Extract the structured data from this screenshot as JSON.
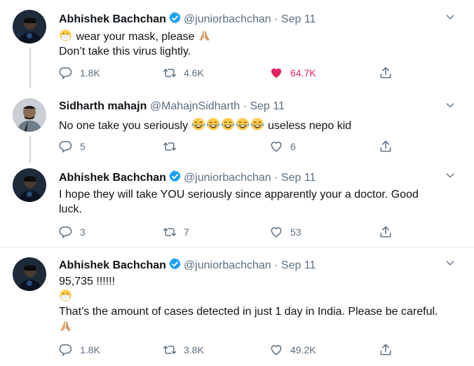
{
  "tweets": [
    {
      "name": "Abhishek Bachchan",
      "handle": "@juniorbachchan · Sep 11",
      "lines": [
        "wear your mask, please",
        "Don’t take this virus lightly."
      ],
      "reply": "1.8K",
      "retweet": "4.6K",
      "like": "64.7K"
    },
    {
      "name": "Sidharth mahajn",
      "handle": "@MahajnSidharth · Sep 11",
      "lines": [
        "No one take you seriously",
        "useless nepo kid"
      ],
      "reply": "5",
      "retweet": "",
      "like": "6"
    },
    {
      "name": "Abhishek Bachchan",
      "handle": "@juniorbachchan · Sep 11",
      "lines": [
        "I hope they will take YOU seriously since apparently your a doctor. Good",
        "luck."
      ],
      "reply": "3",
      "retweet": "7",
      "like": "53"
    },
    {
      "name": "Abhishek Bachchan",
      "handle": "@juniorbachchan · Sep 11",
      "lines": [
        "95,735 !!!!!!",
        "That’s the amount of cases detected in just 1 day in India. Please be careful."
      ],
      "reply": "1.8K",
      "retweet": "3.8K",
      "like": "49.2K"
    }
  ],
  "colors": {
    "like_active": "#e0245e",
    "verified": "#1da1f2",
    "muted": "#5b7083"
  },
  "icons": [
    "reply-icon",
    "retweet-icon",
    "like-icon",
    "share-icon",
    "verified-icon",
    "caret-icon"
  ]
}
